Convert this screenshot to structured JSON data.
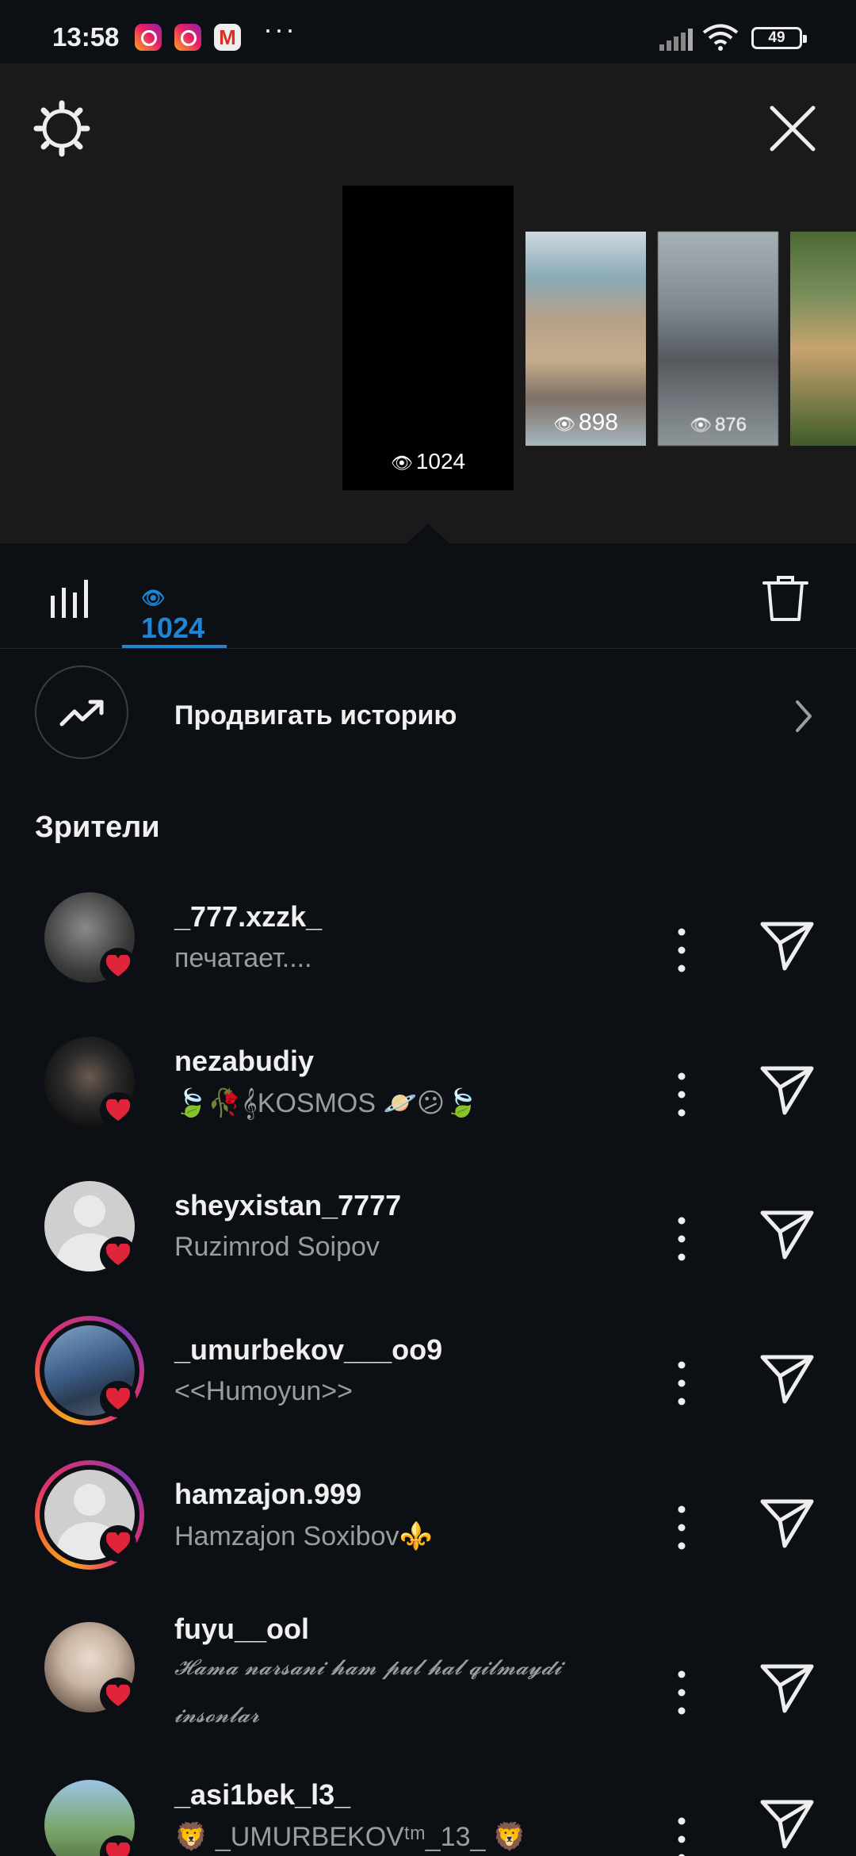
{
  "status_bar": {
    "time": "13:58",
    "notification_icons": [
      "instagram-icon",
      "instagram-icon",
      "gmail-icon"
    ],
    "more_indicator": "···",
    "battery_level": "49",
    "signal_icon": "signal-icon",
    "wifi_icon": "wifi-icon"
  },
  "story_panel": {
    "settings_icon": "gear-icon",
    "close_icon": "close-icon",
    "stories": [
      {
        "views": "1024",
        "active": true
      },
      {
        "views": "898"
      },
      {
        "views": "876"
      },
      {
        "views": ""
      }
    ]
  },
  "tabs": {
    "stats_icon": "bar-chart-icon",
    "viewers_count": "1024",
    "delete_icon": "trash-icon",
    "accent_color": "#1f86d6"
  },
  "promote": {
    "label": "Продвигать историю",
    "icon": "trending-up-icon"
  },
  "viewers_section": {
    "title": "Зрители"
  },
  "viewers": [
    {
      "username": "_777.xzzk_",
      "subtitle": "печатает....",
      "liked": true
    },
    {
      "username": "nezabudiy",
      "subtitle": "🍃🥀𝄞KOSMOS 🪐😕🍃",
      "liked": true
    },
    {
      "username": "sheyxistan_7777",
      "subtitle": "Ruzimrod Soipov",
      "liked": true
    },
    {
      "username": "_umurbekov___oo9",
      "subtitle": "<<Humoyun>>",
      "liked": true,
      "has_story_ring": true
    },
    {
      "username": "hamzajon.999",
      "subtitle": "Hamzajon Soxibov⚜️",
      "liked": true,
      "has_story_ring": true
    },
    {
      "username": "fuyu__ool",
      "subtitle": "𝓗𝓪𝓶𝓪 𝓷𝓪𝓻𝓼𝓪𝓷𝓲 𝓱𝓪𝓶 𝓹𝓾𝓵 𝓱𝓪𝓵 𝓺𝓲𝓵𝓶𝓪𝔂𝓭𝓲 𝓲𝓷𝓼𝓸𝓷𝓵𝓪𝓻",
      "liked": true
    },
    {
      "username": "_asi1bek_l3_",
      "subtitle": "🦁 _UMURBEKOVᵗᵐ_13_ 🦁",
      "liked": true
    }
  ],
  "colors": {
    "background": "#0c0f14",
    "panel": "#1a1a1b",
    "heart": "#e0243a",
    "secondary_text": "#9a9ca0"
  }
}
